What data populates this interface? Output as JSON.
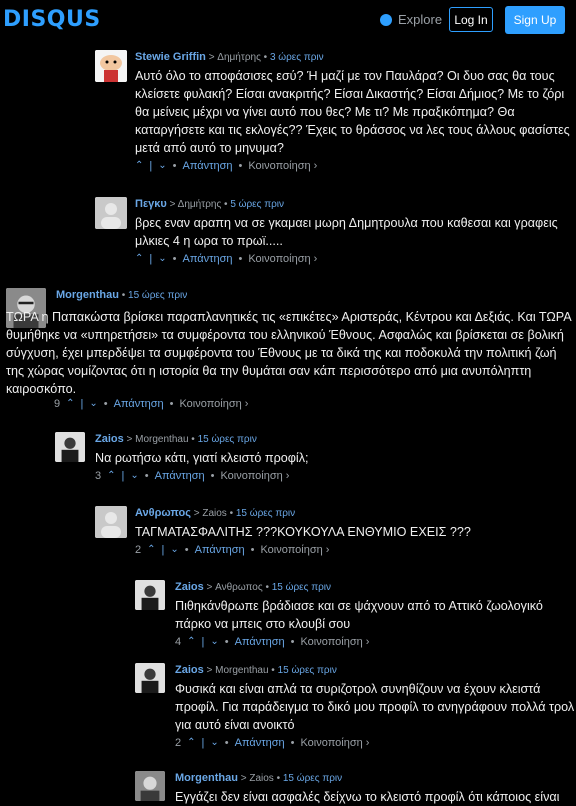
{
  "header": {
    "logo": "DISQUS",
    "explore_label": "Explore",
    "login_label": "Log In",
    "signup_label": "Sign Up"
  },
  "actions": {
    "reply": "Απάντηση",
    "share": "Κοινοποίηση ›"
  },
  "comments": [
    {
      "author": "Stewie Griffin",
      "reply_to": "> Δημήτρης",
      "time": "3 ώρες πριν",
      "text": "Αυτό όλο το αποφάσισες εσύ? Ή μαζί με τον Παυλάρα? Οι δυο σας θα τους κλείσετε φυλακή? Είσαι ανακριτής? Είσαι Δικαστής? Είσαι Δήμιος? Με το ζόρι θα μείνεις μέχρι να γίνει αυτό που θες? Με τι? Με πραξικόπημα? Θα καταργήσετε και τις εκλογές?? Έχεις το θράσσος να λες τους άλλους φασίστες μετά από αυτό το μηνυμα?",
      "votes": ""
    },
    {
      "author": "Πεγκυ",
      "reply_to": "> Δημήτρης",
      "time": "5 ώρες πριν",
      "text": "βρες εναν αραπη να σε γκαμαει μωρη Δημητρουλα που καθεσαι και γραφεις μλκιες 4 η ωρα το πρωϊ.....",
      "votes": ""
    },
    {
      "author": "Morgenthau",
      "reply_to": "",
      "time": "15 ώρες πριν",
      "text": "ΤΩΡΑ η Παπακώστα βρίσκει παραπλανητικές τις «επικέτες» Αριστεράς, Κέντρου και Δεξιάς. Και ΤΩΡΑ θυμήθηκε να «υπηρετήσει» τα συμφέροντα του ελληνικού Έθνους. Ασφαλώς και βρίσκεται σε βολική σύγχυση, έχει μπερδέψει τα συμφέροντα του Έθνους με τα δικά της και ποδοκυλά την πολιτική ζωή της χώρας νομίζοντας ότι η ιστορία θα την θυμάται σαν κάπ περισσότερο από μια ανυπόληπτη καιροσκόπο.",
      "votes": "9"
    },
    {
      "author": "Zaios",
      "reply_to": "> Morgenthau",
      "time": "15 ώρες πριν",
      "text": "Να ρωτήσω κάτι, γιατί κλειστό προφίλ;",
      "votes": "3"
    },
    {
      "author": "Ανθρωπος",
      "reply_to": "> Zaios",
      "time": "15 ώρες πριν",
      "text": "ΤΑΓΜΑΤΑΣΦΑΛΙΤΗΣ ???ΚΟΥΚΟΥΛΑ ΕΝΘΥΜΙΟ ΕΧΕΙΣ ???",
      "votes": "2"
    },
    {
      "author": "Zaios",
      "reply_to": "> Ανθρωπος",
      "time": "15 ώρες πριν",
      "text": "Πιθηκάνθρωπε βράδιασε και σε ψάχνουν από το Αττικό ζωολογικό πάρκο να μπεις στο κλουβί σου",
      "votes": "4"
    },
    {
      "author": "Zaios",
      "reply_to": "> Morgenthau",
      "time": "15 ώρες πριν",
      "text": "Φυσικά και είναι απλά τα συριζοτρολ συνηθίζουν να έχουν κλειστά προφίλ. Για παράδειγμα το δικό μου προφίλ το ανηγράφουν πολλά τρολ για αυτό είναι ανοικτό",
      "votes": "2"
    },
    {
      "author": "Morgenthau",
      "reply_to": "> Zaios",
      "time": "15 ώρες πριν",
      "text": "Εγγάζει δεν είναι ασφαλές δείχνω το κλειστό προφίλ ότι κάποιος είναι",
      "votes": ""
    }
  ]
}
